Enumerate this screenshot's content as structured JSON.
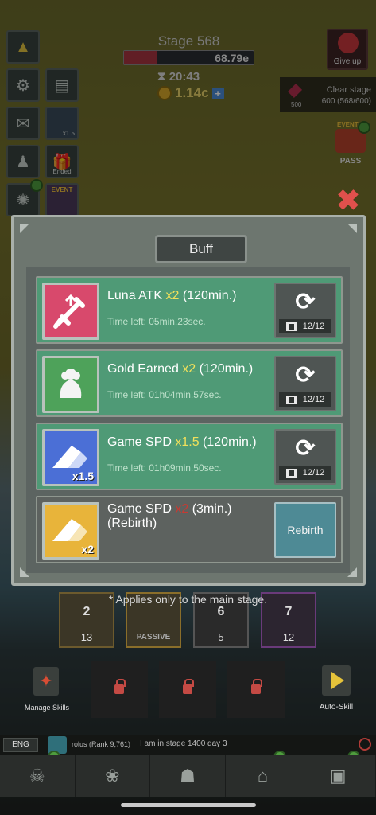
{
  "hud": {
    "stage_title": "Stage 568",
    "boss_hp": "68.79e",
    "boss_hp_fraction": 0.26,
    "timer": "20:43",
    "gold": "1.14c",
    "giveup_label": "Give up",
    "clear_stage_gems": "500",
    "clear_stage_title": "Clear stage",
    "clear_stage_progress": "600 (568/600)",
    "event_label": "EVENT",
    "pass_label": "PASS",
    "side_badge_text": "x1.5",
    "ended_label": "Ended",
    "event_small_label": "EVENT"
  },
  "modal": {
    "title": "Buff",
    "buffs": [
      {
        "name": "Luna ATK ",
        "multiplier": "x2",
        "duration": " (120min.)",
        "time_left": "Time left: 05min.23sec.",
        "uses": "12/12",
        "icon": "sword-icon",
        "color": "#d8496c"
      },
      {
        "name": "Gold Earned ",
        "multiplier": "x2",
        "duration": " (120min.)",
        "time_left": "Time left: 01h04min.57sec.",
        "uses": "12/12",
        "icon": "gold-bag-icon",
        "color": "#4ea25a"
      },
      {
        "name": "Game SPD ",
        "multiplier": "x1.5",
        "duration": " (120min.)",
        "time_left": "Time left: 01h09min.50sec.",
        "uses": "12/12",
        "icon": "speed-eraser-icon",
        "badge": "x1.5",
        "color": "#4b6fd6"
      },
      {
        "name": "Game SPD ",
        "multiplier": "x2",
        "duration": " (3min.)",
        "line2": "(Rebirth)",
        "icon": "speed-eraser-icon",
        "badge": "x2",
        "button": "Rebirth",
        "color": "#e8b43a"
      }
    ]
  },
  "note": "* Applies only to the main stage.",
  "skills": {
    "cards": [
      {
        "num": "2",
        "count": "13"
      },
      {
        "num": "",
        "passive": "PASSIVE"
      },
      {
        "num": "6",
        "count": "5"
      },
      {
        "num": "7",
        "count": "12"
      }
    ],
    "manage_label": "Manage Skills",
    "auto_label": "Auto-Skill"
  },
  "chat": {
    "lang": "ENG",
    "user": "rolus (Rank 9,761)",
    "message": "I am in stage 1400 day 3"
  }
}
